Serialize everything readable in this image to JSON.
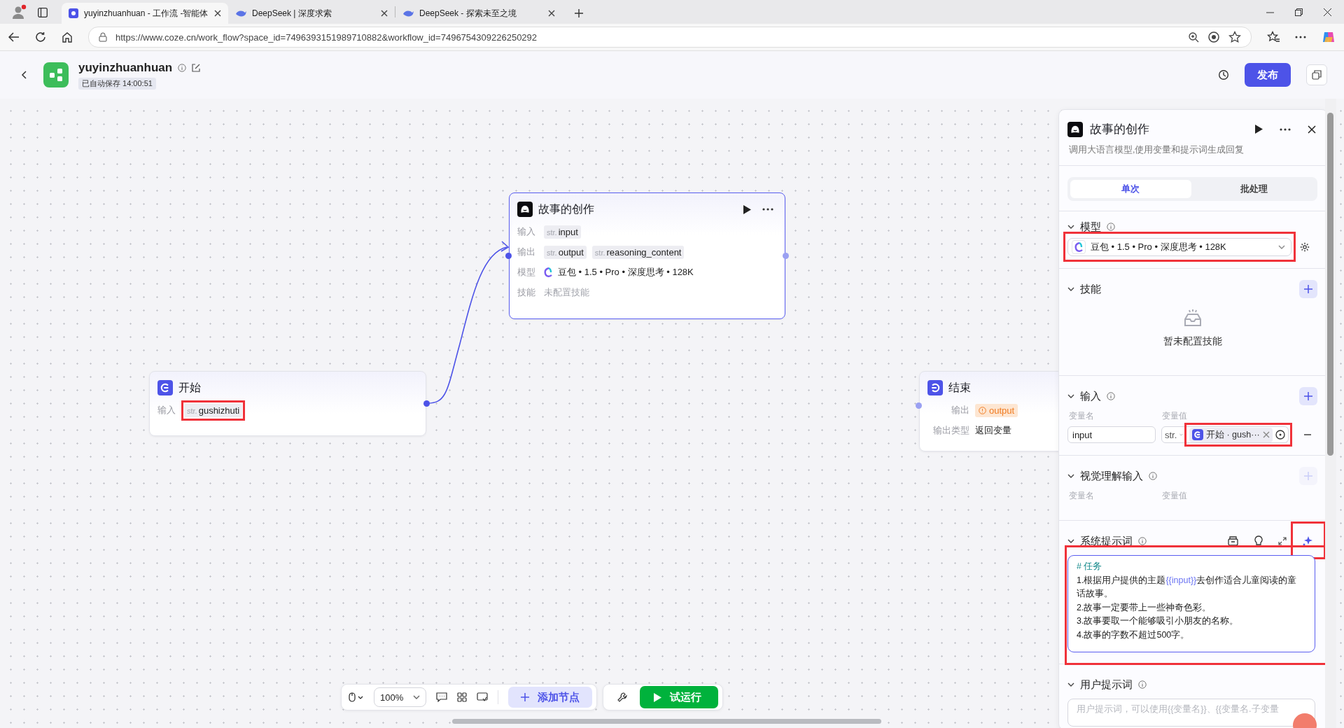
{
  "browser": {
    "tabs": [
      {
        "title": "yuyinzhuanhuan - 工作流 -智能体",
        "selected": true
      },
      {
        "title": "DeepSeek | 深度求索",
        "selected": false
      },
      {
        "title": "DeepSeek - 探索未至之境",
        "selected": false
      }
    ],
    "url": "https://www.coze.cn/work_flow?space_id=7496393151989710882&workflow_id=7496754309226250292"
  },
  "header": {
    "title": "yuyinzhuanhuan",
    "save_status": "已自动保存 14:00:51",
    "publish_label": "发布"
  },
  "nodes": [
    {
      "kind": "llm",
      "title": "故事的创作",
      "selected": true,
      "rows": [
        {
          "label": "输入",
          "kind": "tags",
          "tags": [
            {
              "type": "str.",
              "name": "input",
              "highlighted": false
            }
          ]
        },
        {
          "label": "输出",
          "kind": "tags",
          "tags": [
            {
              "type": "str.",
              "name": "output",
              "highlighted": false
            },
            {
              "type": "str.",
              "name": "reasoning_content",
              "highlighted": false
            }
          ]
        },
        {
          "label": "模型",
          "kind": "model",
          "value": "豆包 • 1.5 • Pro • 深度思考 • 128K"
        },
        {
          "label": "技能",
          "kind": "muted",
          "value": "未配置技能"
        }
      ]
    },
    {
      "kind": "start",
      "title": "开始",
      "selected": false,
      "rows": [
        {
          "label": "输入",
          "kind": "tags",
          "tags": [
            {
              "type": "str.",
              "name": "gushizhuti",
              "highlighted": true
            }
          ]
        }
      ]
    },
    {
      "kind": "end",
      "title": "结束",
      "selected": false,
      "rows": [
        {
          "label": "输出",
          "kind": "warning",
          "value": "output"
        },
        {
          "label": "输出类型",
          "kind": "text",
          "value": "返回变量"
        }
      ]
    }
  ],
  "panel": {
    "title": "故事的创作",
    "description": "调用大语言模型,使用变量和提示词生成回复",
    "modes": [
      {
        "label": "单次",
        "selected": true
      },
      {
        "label": "批处理",
        "selected": false
      }
    ],
    "model": {
      "label": "模型",
      "value": "豆包 • 1.5 • Pro • 深度思考 • 128K",
      "highlighted": true
    },
    "skills": {
      "label": "技能",
      "empty": "暂未配置技能",
      "add_disabled": false
    },
    "inputs": {
      "label": "输入",
      "name_header": "变量名",
      "value_header": "变量值",
      "add_disabled": false,
      "rows": [
        {
          "name": "input",
          "type": "str.",
          "ref": "开始 · gush···",
          "highlighted": true
        }
      ]
    },
    "vision": {
      "label": "视觉理解输入",
      "name_header": "变量名",
      "value_header": "变量值",
      "add_disabled": true
    },
    "system_prompt": {
      "label": "系统提示词",
      "highlighted": true,
      "ai_button_highlighted": true,
      "lines": [
        {
          "kind": "heading",
          "parts": [
            {
              "text": "# 任务",
              "variable": false
            }
          ]
        },
        {
          "kind": "text",
          "parts": [
            {
              "text": "1.根据用户提供的主题",
              "variable": false
            },
            {
              "text": "{{input}}",
              "variable": true
            },
            {
              "text": "去创作适合儿童阅读的童话故事。",
              "variable": false
            }
          ]
        },
        {
          "kind": "text",
          "parts": [
            {
              "text": "2.故事一定要带上一些神奇色彩。",
              "variable": false
            }
          ]
        },
        {
          "kind": "text",
          "parts": [
            {
              "text": "3.故事要取一个能够吸引小朋友的名称。",
              "variable": false
            }
          ]
        },
        {
          "kind": "text",
          "parts": [
            {
              "text": "4.故事的字数不超过500字。",
              "variable": false
            }
          ]
        }
      ]
    },
    "user_prompt": {
      "label": "用户提示词",
      "placeholder": "用户提示词，可以使用{{变量名}}、{{变量名.子变量"
    }
  },
  "toolbar": {
    "zoom": "100%",
    "add_node": "添加节点",
    "test_run": "试运行"
  }
}
